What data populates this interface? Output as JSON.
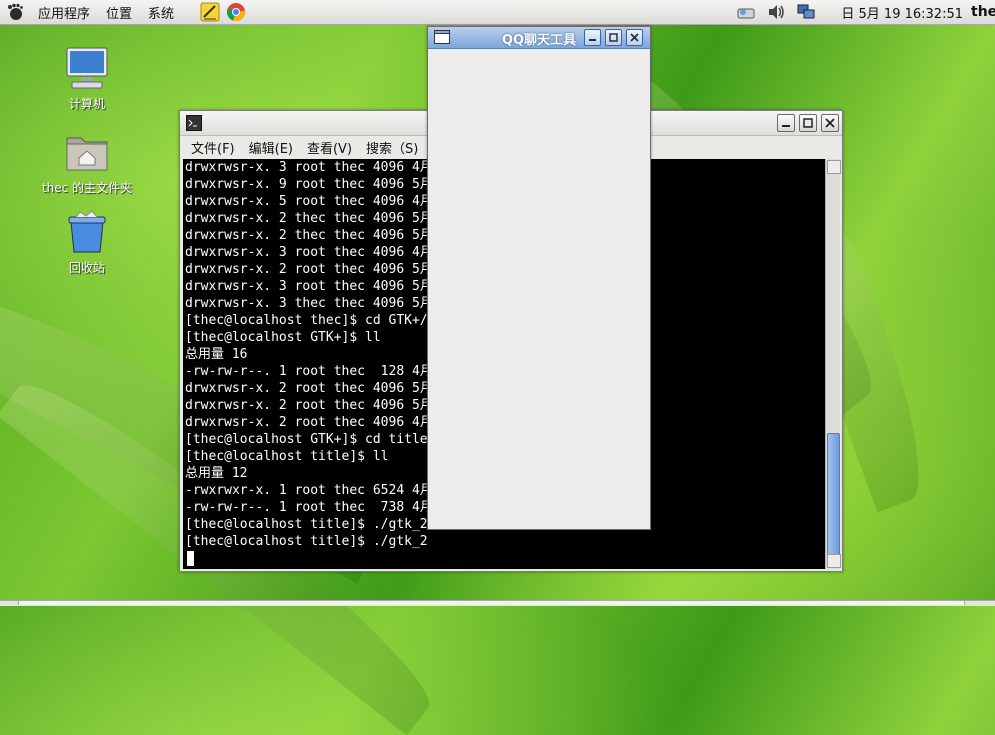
{
  "top_panel": {
    "menus": [
      "应用程序",
      "位置",
      "系统"
    ],
    "clock": "日 5月 19 16:32:51",
    "user": "thec"
  },
  "desktop": {
    "icons": [
      {
        "label": "计算机",
        "icon": "computer-icon"
      },
      {
        "label": "thec 的主文件夹",
        "icon": "home-folder-icon"
      },
      {
        "label": "回收站",
        "icon": "trash-icon"
      }
    ]
  },
  "terminal": {
    "menus": [
      "文件(F)",
      "编辑(E)",
      "查看(V)",
      "搜索（S)"
    ],
    "lines": [
      "drwxrwsr-x. 3 root thec 4096 4月",
      "drwxrwsr-x. 9 root thec 4096 5月",
      "drwxrwsr-x. 5 root thec 4096 4月",
      "drwxrwsr-x. 2 thec thec 4096 5月",
      "drwxrwsr-x. 2 thec thec 4096 5月",
      "drwxrwsr-x. 3 root thec 4096 4月",
      "drwxrwsr-x. 2 root thec 4096 5月",
      "drwxrwsr-x. 3 root thec 4096 5月",
      "drwxrwsr-x. 3 thec thec 4096 5月",
      "[thec@localhost thec]$ cd GTK+/",
      "[thec@localhost GTK+]$ ll",
      "总用量 16",
      "-rw-rw-r--. 1 root thec  128 4月",
      "drwxrwsr-x. 2 root thec 4096 5月",
      "drwxrwsr-x. 2 root thec 4096 5月",
      "drwxrwsr-x. 2 root thec 4096 4月",
      "[thec@localhost GTK+]$ cd title",
      "[thec@localhost title]$ ll",
      "总用量 12",
      "-rwxrwxr-x. 1 root thec 6524 4月",
      "-rw-rw-r--. 1 root thec  738 4月",
      "[thec@localhost title]$ ./gtk_2",
      "[thec@localhost title]$ ./gtk_2"
    ]
  },
  "qq_window": {
    "title": "QQ聊天工具"
  },
  "colors": {
    "desktop_green": "#5fb52a",
    "qq_titlebar": "#8fb1e0",
    "terminal_bg": "#000000"
  }
}
